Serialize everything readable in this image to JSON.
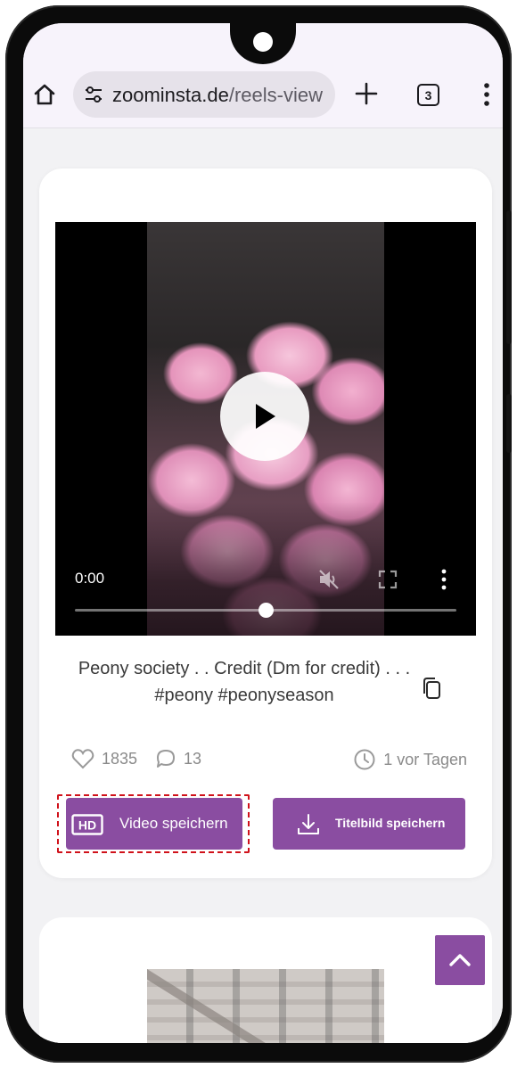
{
  "browser": {
    "url_domain": "zoominsta.de",
    "url_path": "/reels-view",
    "tab_count": "3"
  },
  "post": {
    "video_time": "0:00",
    "video_progress": 0.5,
    "caption": "Peony society . . Credit (Dm for credit) . . . #peony #peonyseason",
    "likes": "1835",
    "comments": "13",
    "date": "1 vor Tagen",
    "download_video_label": "Video speichern",
    "download_thumbnail_label": "Titelbild speichern",
    "hd_badge": "HD"
  },
  "colors": {
    "accent": "#8a4da1",
    "highlight_outline": "#d0121b",
    "screen_background": "#f2f2f4"
  },
  "icons": {
    "home": "home-icon",
    "site_settings": "tune-icon",
    "new_tab": "plus-icon",
    "tabs": "tabs-icon",
    "menu": "kebab-menu-icon",
    "copy": "copy-icon",
    "like": "heart-icon",
    "comment": "speech-bubble-icon",
    "date": "clock-icon",
    "download": "download-icon",
    "scroll_top": "chevron-up-icon"
  }
}
